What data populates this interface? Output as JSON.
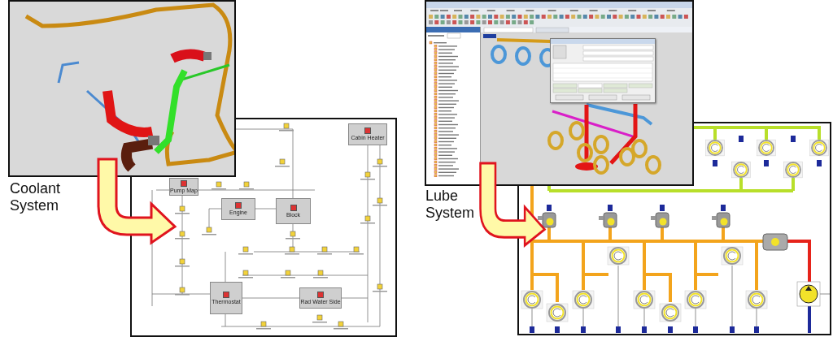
{
  "coolant": {
    "caption": "Coolant System",
    "blocks": [
      {
        "label": "Cabin Heater"
      },
      {
        "label": "Pump Map"
      },
      {
        "label": "Engine"
      },
      {
        "label": "Block"
      },
      {
        "label": "Thermostat"
      },
      {
        "label": "Rad Water Side"
      }
    ]
  },
  "lube": {
    "caption": "Lube System"
  }
}
